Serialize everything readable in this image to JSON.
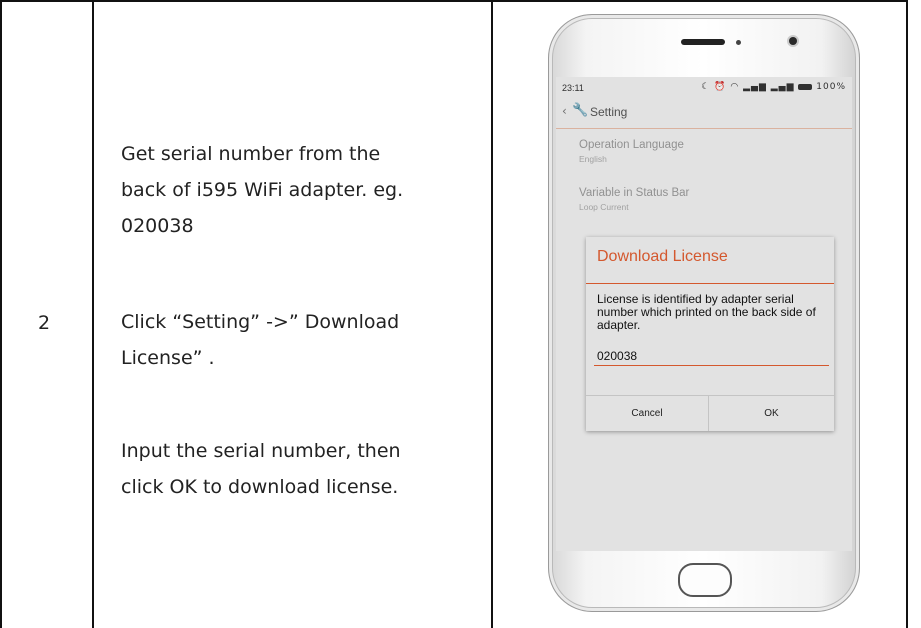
{
  "step": {
    "number": "2"
  },
  "instructions": {
    "para1_lines": [
      "Get serial number from the",
      "back of i595 WiFi adapter. eg.",
      "020038"
    ],
    "para2_lines": [
      "Click “Setting” ->” Download",
      "License” ."
    ],
    "para3_lines": [
      "Input the serial number, then",
      "click OK to download license."
    ]
  },
  "phone": {
    "status_bar": {
      "time": "23:11",
      "battery": "100%"
    },
    "top_bar": {
      "title": "Setting"
    },
    "settings": [
      {
        "title": "Operation Language",
        "subtitle": "English"
      },
      {
        "title": "Variable in Status Bar",
        "subtitle": "Loop Current"
      }
    ],
    "dialog": {
      "title": "Download License",
      "message": "License is identified by adapter serial number which printed on the back side of adapter.",
      "input_value": "020038",
      "cancel_label": "Cancel",
      "ok_label": "OK"
    }
  },
  "colors": {
    "accent": "#d4582e",
    "table_border": "#111111"
  }
}
